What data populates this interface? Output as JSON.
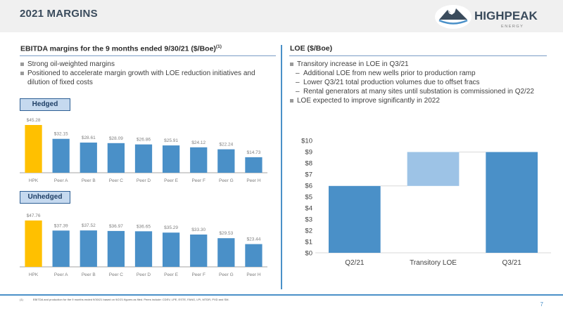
{
  "slide": {
    "title": "2021 MARGINS",
    "page_number": "7"
  },
  "logo": {
    "name": "HIGHPEAK",
    "sub": "E N E R G Y"
  },
  "left": {
    "section_title": "EBITDA margins for the 9 months ended 9/30/21 ($/Boe)",
    "section_title_sup": "(1)",
    "bullets": [
      "Strong oil-weighted margins",
      "Positioned to accelerate margin growth with LOE reduction initiatives and dilution of fixed costs"
    ]
  },
  "right": {
    "section_title": "LOE ($/Boe)",
    "bullets": [
      {
        "text": "Transitory increase in LOE in Q3/21",
        "level": 1
      },
      {
        "text": "Additional LOE from new wells prior to production ramp",
        "level": 2
      },
      {
        "text": "Lower Q3/21 total production volumes due to offset fracs",
        "level": 2
      },
      {
        "text": "Rental generators at many sites until substation is commissioned in Q2/22",
        "level": 2
      },
      {
        "text": "LOE expected to improve significantly in 2022",
        "level": 1
      }
    ]
  },
  "colors": {
    "highlight": "#ffc000",
    "bar": "#4a90c8",
    "bar_light": "#9dc3e6",
    "label": "#7f7f7f",
    "axis": "#a6a6a6"
  },
  "chart_data": [
    {
      "type": "bar",
      "title": "Hedged",
      "categories": [
        "HPK",
        "Peer A",
        "Peer B",
        "Peer C",
        "Peer D",
        "Peer E",
        "Peer F",
        "Peer G",
        "Peer H"
      ],
      "values": [
        45.28,
        32.15,
        28.61,
        28.09,
        26.86,
        25.91,
        24.12,
        22.24,
        14.73
      ],
      "value_labels": [
        "$45.28",
        "$32.15",
        "$28.61",
        "$28.09",
        "$26.86",
        "$25.91",
        "$24.12",
        "$22.24",
        "$14.73"
      ],
      "highlight_index": 0,
      "ylim": [
        0,
        45.28
      ]
    },
    {
      "type": "bar",
      "title": "Unhedged",
      "categories": [
        "HPK",
        "Peer A",
        "Peer B",
        "Peer C",
        "Peer D",
        "Peer E",
        "Peer F",
        "Peer G",
        "Peer H"
      ],
      "values": [
        47.76,
        37.39,
        37.52,
        36.97,
        36.65,
        35.29,
        33.3,
        29.53,
        23.44
      ],
      "value_labels": [
        "$47.76",
        "$37.39",
        "$37.52",
        "$36.97",
        "$36.65",
        "$35.29",
        "$33.30",
        "$29.53",
        "$23.44"
      ],
      "highlight_index": 0,
      "ylim": [
        0,
        47.76
      ]
    },
    {
      "type": "bar",
      "subtype": "waterfall",
      "categories": [
        "Q2/21",
        "Transitory LOE",
        "Q3/21"
      ],
      "bars": [
        {
          "start": 0,
          "end": 5.95
        },
        {
          "start": 5.95,
          "end": 8.97
        },
        {
          "start": 0,
          "end": 8.97
        }
      ],
      "ylim": [
        0,
        10
      ],
      "yticks": [
        0,
        1,
        2,
        3,
        4,
        5,
        6,
        7,
        8,
        9,
        10
      ],
      "ytick_labels": [
        "$0",
        "$1",
        "$2",
        "$3",
        "$4",
        "$5",
        "$6",
        "$7",
        "$8",
        "$9",
        "$10"
      ],
      "grid": false
    }
  ],
  "footnote": {
    "marker": "(1)",
    "text": "EBITDA and production for the 9 months ended 9/30/21 based on 9/2/21 figures as filed. Peers include: CDEV, LPE, ESTE, FANG, LPI, MTDR, PXD and SM."
  }
}
